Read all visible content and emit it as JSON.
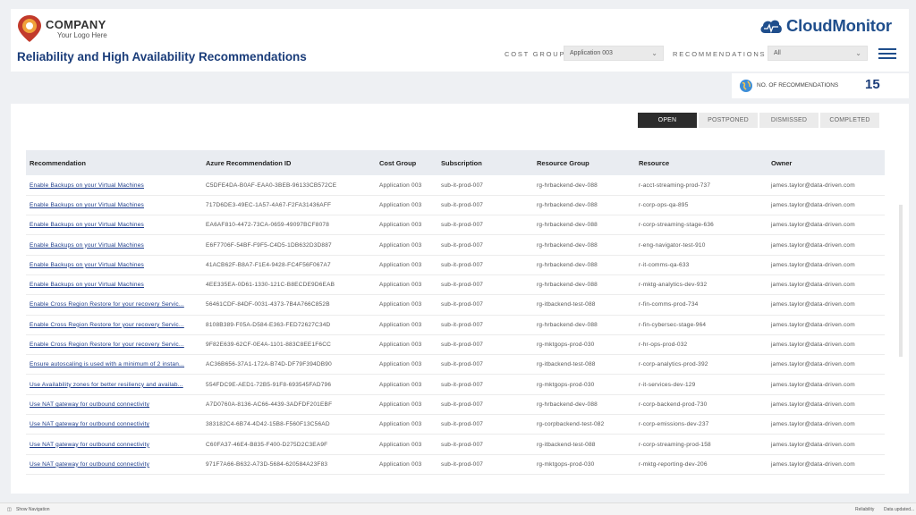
{
  "company": {
    "name": "COMPANY",
    "tagline": "Your Logo Here"
  },
  "page_title": "Reliability and High Availability Recommendations",
  "brand": {
    "name": "CloudMonitor"
  },
  "filters": {
    "cost_group_label": "COST GROUP",
    "cost_group_value": "Application 003",
    "recommendations_label": "RECOMMENDATIONS",
    "recommendations_value": "All"
  },
  "kpi": {
    "label": "NO. OF RECOMMENDATIONS",
    "value": "15"
  },
  "tabs": [
    "OPEN",
    "POSTPONED",
    "DISMISSED",
    "COMPLETED"
  ],
  "table": {
    "headers": [
      "Recommendation",
      "Azure Recommendation ID",
      "Cost Group",
      "Subscription",
      "Resource Group",
      "Resource",
      "Owner"
    ],
    "rows": [
      [
        "Enable Backups on your Virtual Machines",
        "C5DFE4DA-B0AF-EAA0-3BEB-96133CB572CE",
        "Application 003",
        "sub-it-prod-007",
        "rg-hrbackend-dev-088",
        "r-acct-streaming-prod-737",
        "james.taylor@data-driven.com"
      ],
      [
        "Enable Backups on your Virtual Machines",
        "717D6DE3-49EC-1A57-4A67-F2FA31436AFF",
        "Application 003",
        "sub-it-prod-007",
        "rg-hrbackend-dev-088",
        "r-corp-ops-qa-895",
        "james.taylor@data-driven.com"
      ],
      [
        "Enable Backups on your Virtual Machines",
        "EA6AF810-4472-73CA-0659-49097BCF8078",
        "Application 003",
        "sub-it-prod-007",
        "rg-hrbackend-dev-088",
        "r-corp-streaming-stage-636",
        "james.taylor@data-driven.com"
      ],
      [
        "Enable Backups on your Virtual Machines",
        "E6F7706F-54BF-F9F5-C4D5-1DB632D3D887",
        "Application 003",
        "sub-it-prod-007",
        "rg-hrbackend-dev-088",
        "r-eng-navigator-test-910",
        "james.taylor@data-driven.com"
      ],
      [
        "Enable Backups on your Virtual Machines",
        "41ACB62F-B8A7-F1E4-9428-FC4F56F067A7",
        "Application 003",
        "sub-it-prod-007",
        "rg-hrbackend-dev-088",
        "r-it-comms-qa-633",
        "james.taylor@data-driven.com"
      ],
      [
        "Enable Backups on your Virtual Machines",
        "4EE335EA-0D61-1330-121C-B8ECDE9D6EAB",
        "Application 003",
        "sub-it-prod-007",
        "rg-hrbackend-dev-088",
        "r-mktg-analytics-dev-932",
        "james.taylor@data-driven.com"
      ],
      [
        "Enable Cross Region Restore for your recovery Servic...",
        "56461CDF-84DF-0031-4373-7B4A766C852B",
        "Application 003",
        "sub-it-prod-007",
        "rg-itbackend-test-088",
        "r-fin-comms-prod-734",
        "james.taylor@data-driven.com"
      ],
      [
        "Enable Cross Region Restore for your recovery Servic...",
        "8108B389-F05A-D584-E363-FED72627C34D",
        "Application 003",
        "sub-it-prod-007",
        "rg-hrbackend-dev-088",
        "r-fin-cybersec-stage-964",
        "james.taylor@data-driven.com"
      ],
      [
        "Enable Cross Region Restore for your recovery Servic...",
        "9F82E639-62CF-0E4A-1101-883C8EE1F6CC",
        "Application 003",
        "sub-it-prod-007",
        "rg-mktgops-prod-030",
        "r-hr-ops-prod-032",
        "james.taylor@data-driven.com"
      ],
      [
        "Ensure autoscaling is used with a minimum of 2 instan...",
        "AC36B656-37A1-172A-B74D-DF79F394DB90",
        "Application 003",
        "sub-it-prod-007",
        "rg-itbackend-test-088",
        "r-corp-analytics-prod-392",
        "james.taylor@data-driven.com"
      ],
      [
        "Use Availability zones for better resiliency and availab...",
        "554FDC9E-AED1-72B5-91F8-693545FAD796",
        "Application 003",
        "sub-it-prod-007",
        "rg-mktgops-prod-030",
        "r-it-services-dev-129",
        "james.taylor@data-driven.com"
      ],
      [
        "Use NAT gateway for outbound connectivity",
        "A7D0760A-8136-AC66-4439-3ADFDF201EBF",
        "Application 003",
        "sub-it-prod-007",
        "rg-hrbackend-dev-088",
        "r-corp-backend-prod-730",
        "james.taylor@data-driven.com"
      ],
      [
        "Use NAT gateway for outbound connectivity",
        "383182C4-6B74-4D42-15B8-F560F13C56AD",
        "Application 003",
        "sub-it-prod-007",
        "rg-corpbackend-test-082",
        "r-corp-emissions-dev-237",
        "james.taylor@data-driven.com"
      ],
      [
        "Use NAT gateway for outbound connectivity",
        "C60FA37-46E4-B835-F400-D275D2C3EA9F",
        "Application 003",
        "sub-it-prod-007",
        "rg-itbackend-test-088",
        "r-corp-streaming-prod-158",
        "james.taylor@data-driven.com"
      ],
      [
        "Use NAT gateway for outbound connectivity",
        "971F7A66-B632-A73D-5684-620584A23F83",
        "Application 003",
        "sub-it-prod-007",
        "rg-mktgops-prod-030",
        "r-mktg-reporting-dev-206",
        "james.taylor@data-driven.com"
      ]
    ]
  },
  "bottom_bar": {
    "show_navigation": "Show Navigation",
    "page_name": "Reliability",
    "data_status": "Data updated..."
  },
  "colors": {
    "title_blue": "#1b3d7a",
    "brand_blue": "#1f4e8c",
    "active_tab": "#2c2c2c",
    "link_blue": "#1a3a8a",
    "logo_red": "#c23a2b",
    "logo_orange": "#f0a23a"
  }
}
